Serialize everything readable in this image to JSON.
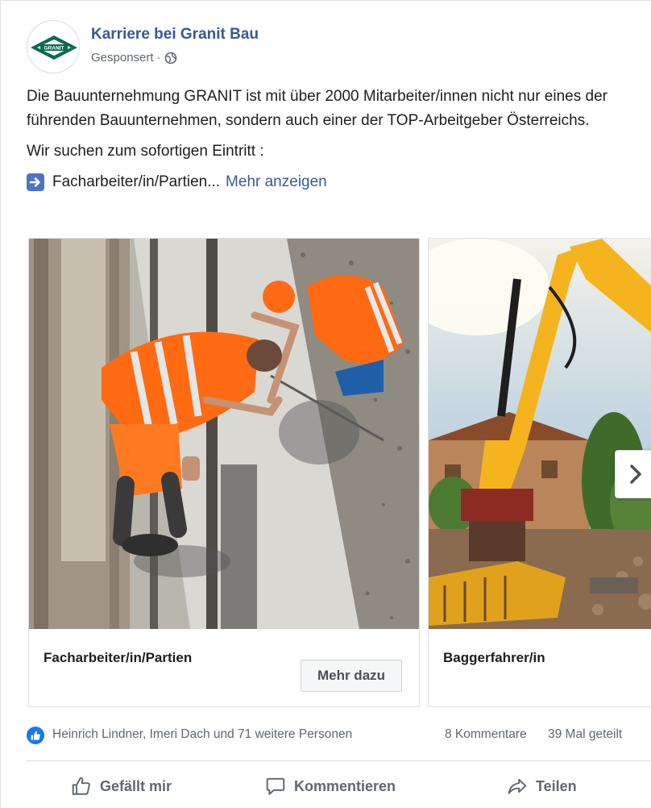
{
  "post": {
    "page_name": "Karriere bei Granit Bau",
    "sponsored_label": "Gesponsert",
    "separator": "·",
    "logo_text": "GRANIT",
    "paragraph1": "Die Bauunternehmung GRANIT ist mit über 2000 Mitarbeiter/innen nicht nur eines der führenden Bauunternehmen, sondern auch einer der TOP-Arbeitgeber Österreichs.",
    "paragraph2": "Wir suchen zum sofortigen Eintritt :",
    "paragraph3": "Facharbeiter/in/Partien...",
    "more_link": "Mehr anzeigen",
    "icons": {
      "globe": "globe-icon",
      "arrow": "right-arrow-emoji-icon"
    }
  },
  "carousel": {
    "cards": [
      {
        "title": "Facharbeiter/in/Partien",
        "cta": "Mehr dazu",
        "image": "construction-workers-photo"
      },
      {
        "title": "Baggerfahrer/in",
        "image": "excavator-photo"
      }
    ],
    "next_icon": "chevron-right-icon"
  },
  "engagement": {
    "reactors": "Heinrich Lindner, Imeri Dach und 71 weitere Personen",
    "comments": "8 Kommentare",
    "shares": "39 Mal geteilt"
  },
  "actions": {
    "like": "Gefällt mir",
    "comment": "Kommentieren",
    "share": "Teilen"
  },
  "colors": {
    "link": "#385898",
    "like_blue": "#1877f2",
    "safety_orange": "#ff6a13",
    "excavator_yellow": "#f5b41e",
    "logo_green": "#0b6b4f"
  }
}
